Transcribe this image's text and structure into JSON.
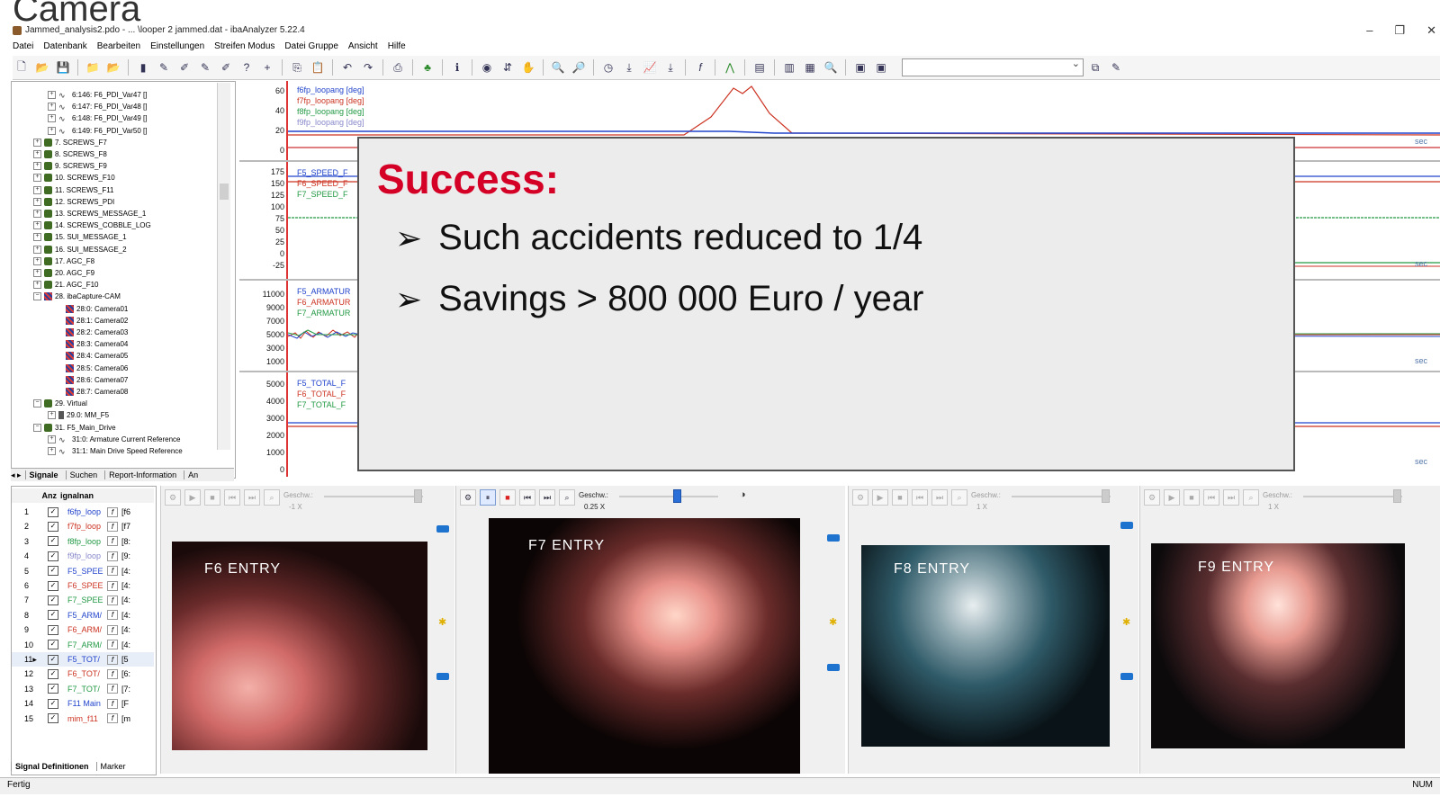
{
  "slide": {
    "title": "Camera"
  },
  "window": {
    "title": "Jammed_analysis2.pdo - ... \\looper 2 jammed.dat - ibaAnalyzer 5.22.4",
    "controls": [
      "–",
      "❐",
      "✕"
    ]
  },
  "menu": [
    "Datei",
    "Datenbank",
    "Bearbeiten",
    "Einstellungen",
    "Streifen Modus",
    "Datei Gruppe",
    "Ansicht",
    "Hilfe"
  ],
  "tree": {
    "items": [
      {
        "expander": "+",
        "icon": "sig",
        "label": "6:146: F6_PDI_Var47 []"
      },
      {
        "expander": "+",
        "icon": "sig",
        "label": "6:147: F6_PDI_Var48 []"
      },
      {
        "expander": "+",
        "icon": "sig",
        "label": "6:148: F6_PDI_Var49 []"
      },
      {
        "expander": "+",
        "icon": "sig",
        "label": "6:149: F6_PDI_Var50 []"
      },
      {
        "expander": "+",
        "icon": "mod",
        "label": "7. SCREWS_F7"
      },
      {
        "expander": "+",
        "icon": "mod",
        "label": "8. SCREWS_F8"
      },
      {
        "expander": "+",
        "icon": "mod",
        "label": "9. SCREWS_F9"
      },
      {
        "expander": "+",
        "icon": "mod",
        "label": "10. SCREWS_F10"
      },
      {
        "expander": "+",
        "icon": "mod",
        "label": "11. SCREWS_F11"
      },
      {
        "expander": "+",
        "icon": "mod",
        "label": "12. SCREWS_PDI"
      },
      {
        "expander": "+",
        "icon": "mod",
        "label": "13. SCREWS_MESSAGE_1"
      },
      {
        "expander": "+",
        "icon": "mod",
        "label": "14. SCREWS_COBBLE_LOG"
      },
      {
        "expander": "+",
        "icon": "mod",
        "label": "15. SUI_MESSAGE_1"
      },
      {
        "expander": "+",
        "icon": "mod",
        "label": "16. SUI_MESSAGE_2"
      },
      {
        "expander": "+",
        "icon": "mod",
        "label": "17. AGC_F8"
      },
      {
        "expander": "+",
        "icon": "mod",
        "label": "20. AGC_F9"
      },
      {
        "expander": "+",
        "icon": "mod",
        "label": "21. AGC_F10"
      },
      {
        "expander": "−",
        "icon": "cam",
        "label": "28. ibaCapture-CAM"
      },
      {
        "expander": "",
        "icon": "cam",
        "label": "28:0: Camera01"
      },
      {
        "expander": "",
        "icon": "cam",
        "label": "28:1: Camera02"
      },
      {
        "expander": "",
        "icon": "cam",
        "label": "28:2: Camera03"
      },
      {
        "expander": "",
        "icon": "cam",
        "label": "28:3: Camera04"
      },
      {
        "expander": "",
        "icon": "cam",
        "label": "28:4: Camera05"
      },
      {
        "expander": "",
        "icon": "cam",
        "label": "28:5: Camera06"
      },
      {
        "expander": "",
        "icon": "cam",
        "label": "28:6: Camera07"
      },
      {
        "expander": "",
        "icon": "cam",
        "label": "28:7: Camera08"
      },
      {
        "expander": "−",
        "icon": "mod",
        "label": "29. Virtual"
      },
      {
        "expander": "+",
        "icon": "vid",
        "label": "29.0: MM_F5"
      },
      {
        "expander": "−",
        "icon": "mod",
        "label": "31. F5_Main_Drive"
      },
      {
        "expander": "+",
        "icon": "sig",
        "label": "31:0: Armature Current Reference"
      },
      {
        "expander": "+",
        "icon": "sig",
        "label": "31:1: Main Drive Speed Reference"
      }
    ],
    "tabs": [
      "Signale",
      "Suchen",
      "Report-Information",
      "An"
    ]
  },
  "graphs": [
    {
      "ticks": [
        "60",
        "40",
        "20",
        "0"
      ],
      "legend": [
        "f6fp_loopang [deg]",
        "f7fp_loopang [deg]",
        "f8fp_loopang [deg]",
        "f9fp_loopang [deg]"
      ],
      "legend_colors": [
        "#2244cc",
        "#cc3322",
        "#229944",
        "#8888cc"
      ],
      "unit": "sec"
    },
    {
      "ticks": [
        "175",
        "150",
        "125",
        "100",
        "75",
        "50",
        "25",
        "0",
        "-25"
      ],
      "legend": [
        "F5_SPEED_F",
        "F6_SPEED_F",
        "F7_SPEED_F"
      ],
      "legend_colors": [
        "#2244cc",
        "#cc3322",
        "#229944"
      ],
      "unit": "sec"
    },
    {
      "ticks": [
        "11000",
        "9000",
        "7000",
        "5000",
        "3000",
        "1000"
      ],
      "legend": [
        "F5_ARMATUR",
        "F6_ARMATUR",
        "F7_ARMATUR"
      ],
      "legend_colors": [
        "#2244cc",
        "#cc3322",
        "#229944"
      ],
      "unit": "sec"
    },
    {
      "ticks": [
        "5000",
        "4000",
        "3000",
        "2000",
        "1000",
        "0"
      ],
      "legend": [
        "F5_TOTAL_F",
        "F6_TOTAL_F",
        "F7_TOTAL_F"
      ],
      "legend_colors": [
        "#2244cc",
        "#cc3322",
        "#229944"
      ],
      "unit": "sec"
    }
  ],
  "overlay": {
    "heading": "Success:",
    "bullets": [
      "Such accidents reduced to 1/4",
      "Savings  > 800 000 Euro / year"
    ]
  },
  "signals": {
    "header": {
      "anz": "Anz",
      "name": "ignalnan"
    },
    "rows": [
      {
        "n": "1",
        "name": "f6fp_loop",
        "color": "#2244cc",
        "unit": "[f6"
      },
      {
        "n": "2",
        "name": "f7fp_loop",
        "color": "#cc3322",
        "unit": "[f7"
      },
      {
        "n": "3",
        "name": "f8fp_loop",
        "color": "#229944",
        "unit": "[8:"
      },
      {
        "n": "4",
        "name": "f9fp_loop",
        "color": "#8888cc",
        "unit": "[9:"
      },
      {
        "n": "5",
        "name": "F5_SPEE",
        "color": "#2244cc",
        "unit": "[4:"
      },
      {
        "n": "6",
        "name": "F6_SPEE",
        "color": "#cc3322",
        "unit": "[4:"
      },
      {
        "n": "7",
        "name": "F7_SPEE",
        "color": "#229944",
        "unit": "[4:"
      },
      {
        "n": "8",
        "name": "F5_ARM/",
        "color": "#2244cc",
        "unit": "[4:"
      },
      {
        "n": "9",
        "name": "F6_ARM/",
        "color": "#cc3322",
        "unit": "[4:"
      },
      {
        "n": "10",
        "name": "F7_ARM/",
        "color": "#229944",
        "unit": "[4:"
      },
      {
        "n": "11▸",
        "name": "F5_TOT/",
        "color": "#2244cc",
        "unit": "[5"
      },
      {
        "n": "12",
        "name": "F6_TOT/",
        "color": "#cc3322",
        "unit": "[6:"
      },
      {
        "n": "13",
        "name": "F7_TOT/",
        "color": "#229944",
        "unit": "[7:"
      },
      {
        "n": "14",
        "name": "F11 Main",
        "color": "#2244cc",
        "unit": "[F"
      },
      {
        "n": "15",
        "name": "mim_f11",
        "color": "#cc3322",
        "unit": "[m"
      }
    ],
    "tabs": [
      "Signal Definitionen",
      "Marker"
    ]
  },
  "videos": [
    {
      "label": "F6  ENTRY",
      "speed_label": "Geschw.:",
      "speed": "-1 X",
      "active": false
    },
    {
      "label": "F7  ENTRY",
      "speed_label": "Geschw.:",
      "speed": "0.25 X",
      "active": true
    },
    {
      "label": "F8  ENTRY",
      "speed_label": "Geschw.:",
      "speed": "1 X",
      "active": false
    },
    {
      "label": "F9  ENTRY",
      "speed_label": "Geschw.:",
      "speed": "1 X",
      "active": false
    }
  ],
  "status": {
    "left": "Fertig",
    "right": "NUM"
  }
}
